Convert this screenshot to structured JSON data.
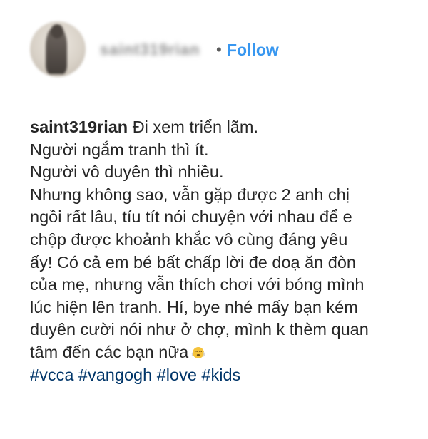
{
  "header": {
    "username_blurred": "saint319rian",
    "separator": "•",
    "follow_label": "Follow"
  },
  "caption": {
    "author": "saint319rian",
    "lines": [
      "Đi xem triển lãm.",
      "Người ngắm tranh thì ít.",
      "Người vô duyên thì nhiều.",
      "Nhưng không sao, vẫn gặp được 2 anh chị",
      "ngồi rất lâu, tíu tít nói chuyện với nhau để e",
      "chộp được khoảnh khắc vô cùng đáng yêu",
      "ấy! Có cả em bé bất chấp lời đe doạ ăn đòn",
      "của mẹ, nhưng vẫn thích chơi với bóng mình",
      "lúc hiện lên tranh. Hí, bye nhé mấy bạn kém",
      "duyên cười nói như ở chợ, mình k thèm quan",
      "tâm đến các bạn nữa"
    ],
    "emoji": "face-with-steam-icon",
    "hashtags": [
      "#vcca",
      "#vangogh",
      "#love",
      "#kids"
    ]
  },
  "colors": {
    "follow": "#3897f0",
    "hashtag": "#003569",
    "text": "#262626",
    "divider": "#e6e6e6"
  }
}
